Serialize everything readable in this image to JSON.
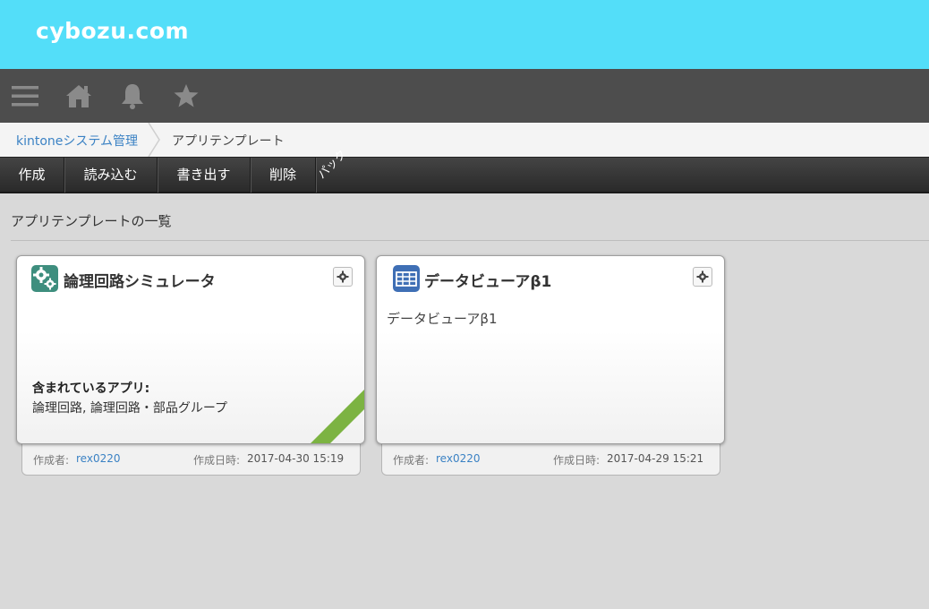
{
  "header": {
    "logo": "cybozu.com"
  },
  "nav": {
    "icons": [
      "menu-icon",
      "home-icon",
      "bell-icon",
      "star-icon"
    ]
  },
  "breadcrumb": {
    "link": "kintoneシステム管理",
    "current": "アプリテンプレート"
  },
  "toolbar": {
    "create": "作成",
    "import": "読み込む",
    "export": "書き出す",
    "delete": "削除"
  },
  "section": {
    "title": "アプリテンプレートの一覧"
  },
  "templates": [
    {
      "title": "論理回路シミュレータ",
      "icon": "gears-icon",
      "included_label": "含まれているアプリ:",
      "included_apps": "論理回路, 論理回路・部品グループ",
      "badge": "パック",
      "creator_label": "作成者:",
      "creator": "rex0220",
      "created_label": "作成日時:",
      "created": "2017-04-30 15:19"
    },
    {
      "title": "データビューアβ1",
      "icon": "table-icon",
      "description": "データビューアβ1",
      "creator_label": "作成者:",
      "creator": "rex0220",
      "created_label": "作成日時:",
      "created": "2017-04-29 15:21"
    }
  ],
  "colors": {
    "topbar": "#53def9",
    "navbar": "#4d4d4d",
    "link": "#3b82c4",
    "ribbon": "#7cb342"
  }
}
